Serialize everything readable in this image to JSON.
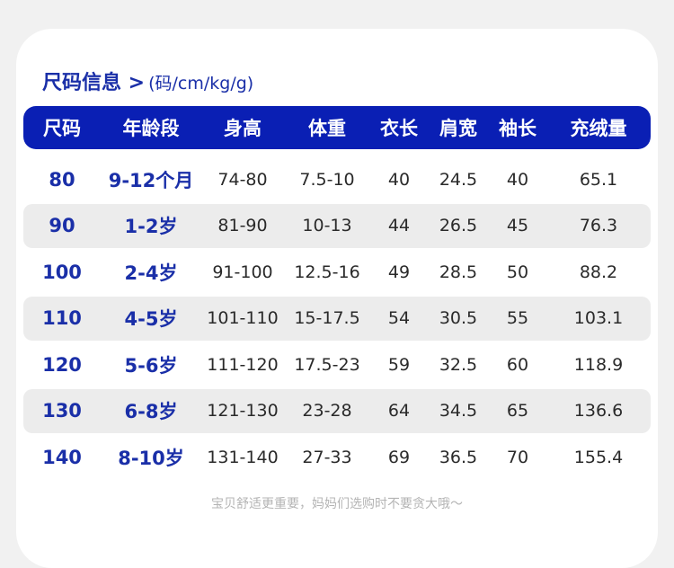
{
  "heading": {
    "title": "尺码信息 >",
    "units": "(码/cm/kg/g)"
  },
  "table": {
    "columns": [
      "尺码",
      "年龄段",
      "身高",
      "体重",
      "衣长",
      "肩宽",
      "袖长",
      "充绒量"
    ],
    "rows": [
      [
        "80",
        "9-12个月",
        "74-80",
        "7.5-10",
        "40",
        "24.5",
        "40",
        "65.1"
      ],
      [
        "90",
        "1-2岁",
        "81-90",
        "10-13",
        "44",
        "26.5",
        "45",
        "76.3"
      ],
      [
        "100",
        "2-4岁",
        "91-100",
        "12.5-16",
        "49",
        "28.5",
        "50",
        "88.2"
      ],
      [
        "110",
        "4-5岁",
        "101-110",
        "15-17.5",
        "54",
        "30.5",
        "55",
        "103.1"
      ],
      [
        "120",
        "5-6岁",
        "111-120",
        "17.5-23",
        "59",
        "32.5",
        "60",
        "118.9"
      ],
      [
        "130",
        "6-8岁",
        "121-130",
        "23-28",
        "64",
        "34.5",
        "65",
        "136.6"
      ],
      [
        "140",
        "8-10岁",
        "131-140",
        "27-33",
        "69",
        "36.5",
        "70",
        "155.4"
      ]
    ]
  },
  "footnote": "宝贝舒适更重要，妈妈们选购时不要贪大哦～",
  "colors": {
    "accent": "#0a1fb4",
    "accent_text": "#1a2fa8",
    "row_shade": "#ececec",
    "background": "#f1f1f1"
  }
}
